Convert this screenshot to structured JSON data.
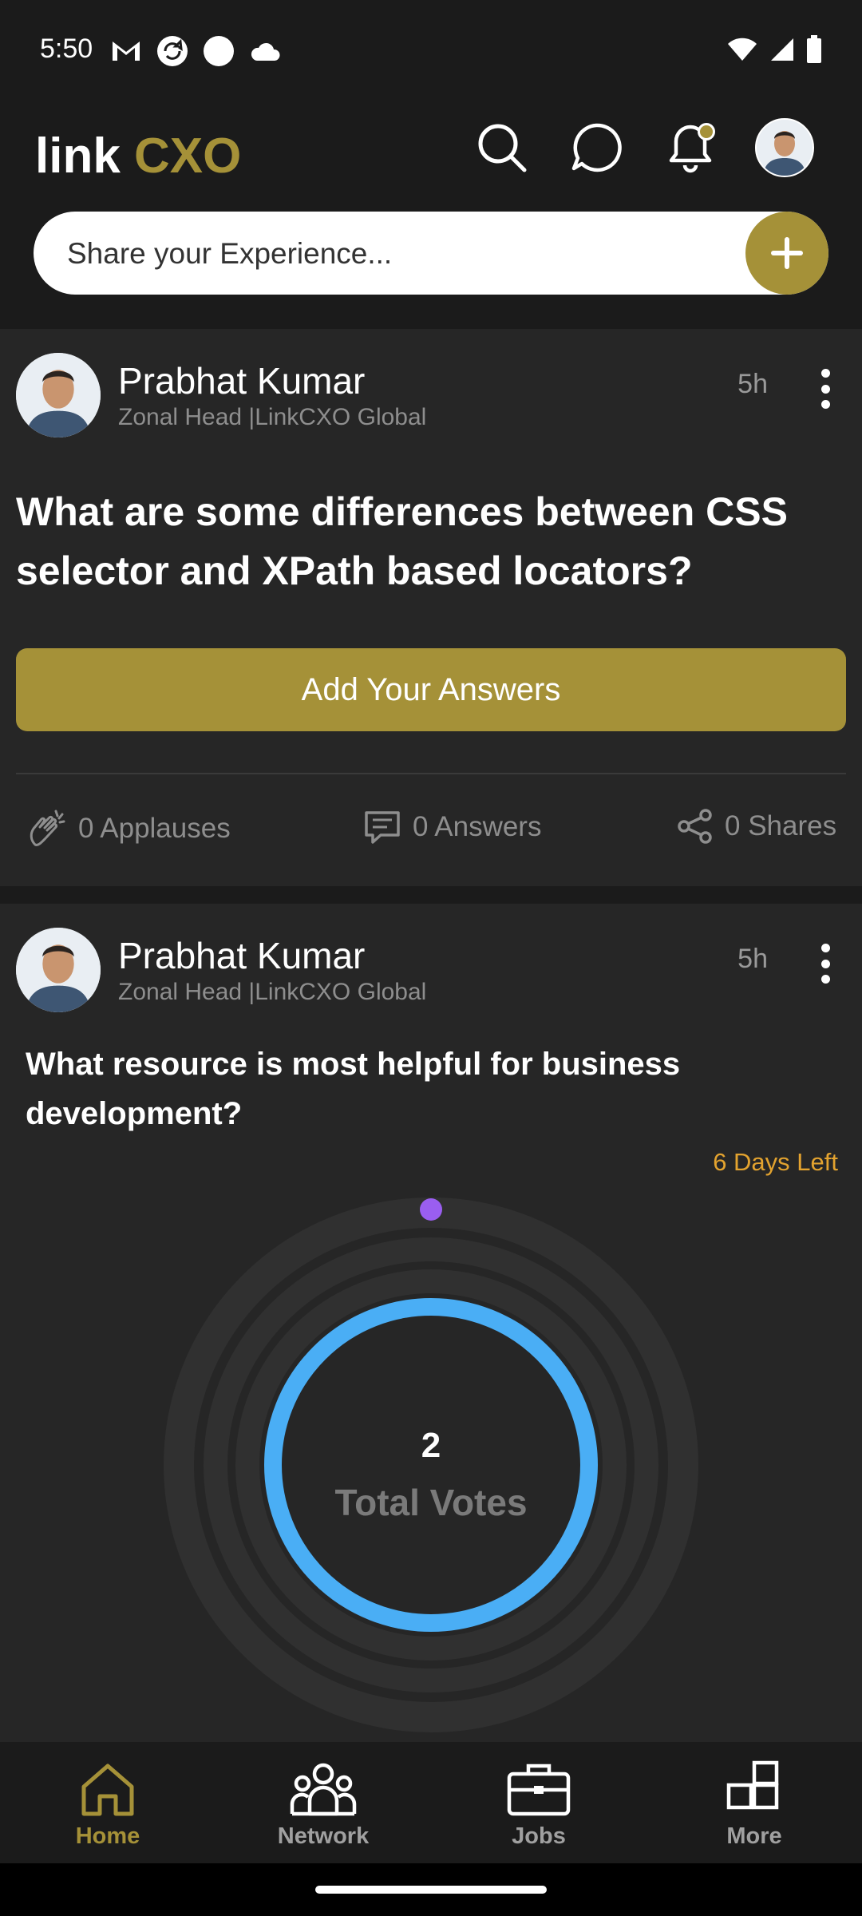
{
  "status": {
    "time": "5:50"
  },
  "header": {
    "logo_text": "linkCXO",
    "share_placeholder": "Share your Experience..."
  },
  "posts": [
    {
      "author": "Prabhat Kumar",
      "role": "Zonal Head |LinkCXO Global",
      "time": "5h",
      "question": "What are some differences between CSS selector and XPath based locators?",
      "answer_button": "Add Your Answers",
      "applauses": "0 Applauses",
      "answers": "0 Answers",
      "shares": "0 Shares"
    },
    {
      "author": "Prabhat Kumar",
      "role": "Zonal Head |LinkCXO Global",
      "time": "5h",
      "question": "What resource is most helpful for business development?",
      "days_left": "6 Days Left",
      "total_votes_value": "2",
      "total_votes_label": "Total Votes"
    }
  ],
  "nav": [
    {
      "label": "Home",
      "active": true
    },
    {
      "label": "Network",
      "active": false
    },
    {
      "label": "Jobs",
      "active": false
    },
    {
      "label": "More",
      "active": false
    }
  ],
  "colors": {
    "accent": "#a59138",
    "poll_ring": "#4aaef5",
    "poll_dot": "#9a5ef0",
    "days_left": "#e3a32f"
  }
}
